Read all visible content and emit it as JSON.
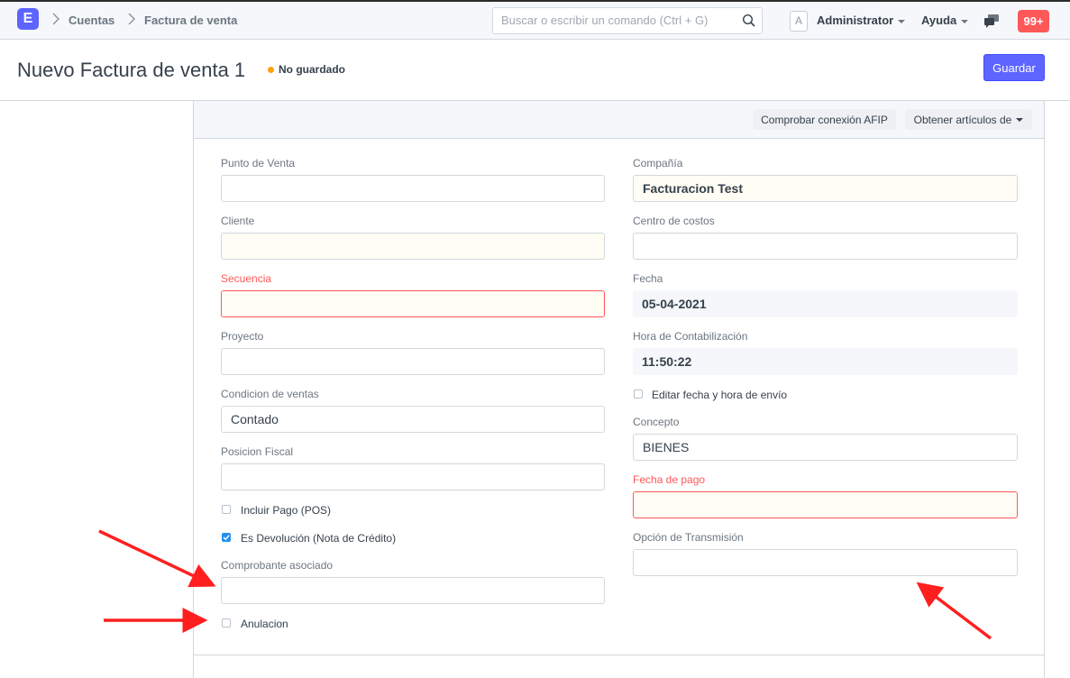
{
  "navbar": {
    "logo": "E",
    "breadcrumbs": [
      "Cuentas",
      "Factura de venta"
    ],
    "search_placeholder": "Buscar o escribir un comando (Ctrl + G)",
    "avatar": "A",
    "user_menu": "Administrator",
    "help_menu": "Ayuda",
    "notification_count": "99+"
  },
  "page": {
    "title": "Nuevo Factura de venta 1",
    "status": "No guardado",
    "save_label": "Guardar"
  },
  "toolbar": {
    "afip_label": "Comprobar conexión AFIP",
    "get_items_label": "Obtener artículos de"
  },
  "form": {
    "left": {
      "punto_venta": {
        "label": "Punto de Venta",
        "value": ""
      },
      "cliente": {
        "label": "Cliente",
        "value": ""
      },
      "secuencia": {
        "label": "Secuencia",
        "value": ""
      },
      "proyecto": {
        "label": "Proyecto",
        "value": ""
      },
      "condicion_ventas": {
        "label": "Condicion de ventas",
        "value": "Contado"
      },
      "posicion_fiscal": {
        "label": "Posicion Fiscal",
        "value": ""
      },
      "incluir_pago": {
        "label": "Incluir Pago (POS)",
        "checked": false
      },
      "es_devolucion": {
        "label": "Es Devolución (Nota de Crédito)",
        "checked": true
      },
      "comprobante_asociado": {
        "label": "Comprobante asociado",
        "value": ""
      },
      "anulacion": {
        "label": "Anulacion",
        "checked": false
      }
    },
    "right": {
      "compania": {
        "label": "Compañía",
        "value": "Facturacion Test"
      },
      "centro_costos": {
        "label": "Centro de costos",
        "value": ""
      },
      "fecha": {
        "label": "Fecha",
        "value": "05-04-2021"
      },
      "hora": {
        "label": "Hora de Contabilización",
        "value": "11:50:22"
      },
      "editar_fecha": {
        "label": "Editar fecha y hora de envío",
        "checked": false
      },
      "concepto": {
        "label": "Concepto",
        "value": "BIENES"
      },
      "fecha_pago": {
        "label": "Fecha de pago",
        "value": ""
      },
      "opcion_transmision": {
        "label": "Opción de Transmisión",
        "value": ""
      }
    }
  },
  "colors": {
    "primary": "#5e64ff",
    "error": "#ff5858",
    "status_dot": "#ffa00a",
    "annotation_arrow": "#ff1f1f"
  },
  "icons": [
    "chevron-right-icon",
    "search-icon",
    "chat-icon",
    "checkmark-icon",
    "red-arrow-annotation"
  ]
}
